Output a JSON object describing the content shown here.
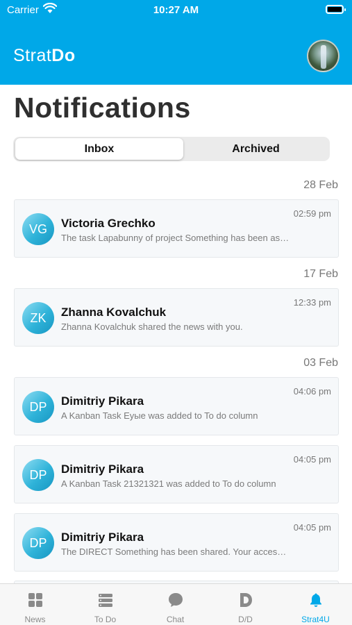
{
  "status_bar": {
    "carrier": "Carrier",
    "time": "10:27 AM"
  },
  "header": {
    "logo_part1": "Strat",
    "logo_part2": "Do",
    "avatar_icon": "user-avatar-photo"
  },
  "page": {
    "title": "Notifications"
  },
  "segments": {
    "inbox": "Inbox",
    "archived": "Archived",
    "selected": "Inbox"
  },
  "groups": [
    {
      "date": "28 Feb",
      "items": [
        {
          "initials": "VG",
          "name": "Victoria Grechko",
          "message": "The task Lapabunny of project Something has been assi...",
          "time": "02:59 pm"
        }
      ]
    },
    {
      "date": "17 Feb",
      "items": [
        {
          "initials": "ZK",
          "name": "Zhanna Kovalchuk",
          "message": "Zhanna Kovalchuk shared the news with you.",
          "time": "12:33 pm"
        }
      ]
    },
    {
      "date": "03 Feb",
      "items": [
        {
          "initials": "DP",
          "name": "Dimitriy Pikara",
          "message": "A Kanban Task Еуые was added to To do column",
          "time": "04:06 pm"
        },
        {
          "initials": "DP",
          "name": "Dimitriy Pikara",
          "message": "A Kanban Task 21321321 was added to To do column",
          "time": "04:05 pm"
        },
        {
          "initials": "DP",
          "name": "Dimitriy Pikara",
          "message": "The DIRECT Something has been shared. Your access le...",
          "time": "04:05 pm"
        }
      ]
    }
  ],
  "tabbar": {
    "active": "Strat4U",
    "accent": "#00A8E8",
    "inactive_color": "#8a8a8a",
    "tabs": [
      {
        "label": "News",
        "icon": "grid-icon"
      },
      {
        "label": "To Do",
        "icon": "list-icon"
      },
      {
        "label": "Chat",
        "icon": "chat-bubble-icon"
      },
      {
        "label": "D/D",
        "icon": "letter-d-icon"
      },
      {
        "label": "Strat4U",
        "icon": "bell-icon"
      }
    ]
  },
  "colors": {
    "header_bg": "#00A8E8",
    "avatar_gradient_end": "#1796c2"
  }
}
